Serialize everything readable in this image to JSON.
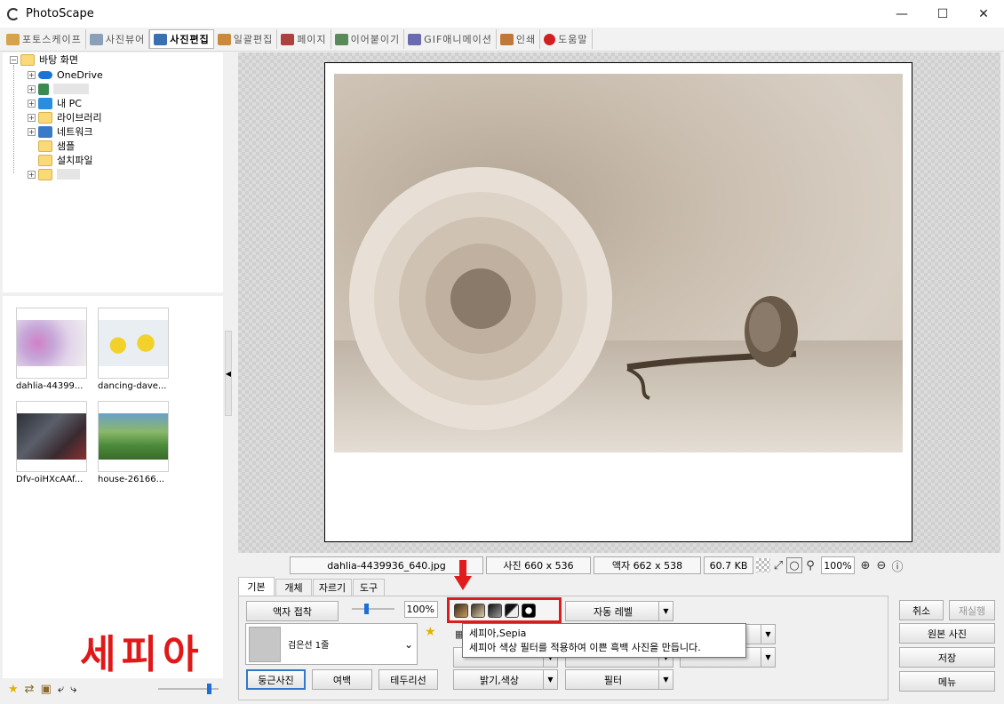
{
  "window": {
    "title": "PhotoScape"
  },
  "tabs": [
    {
      "label": "포토스케이프",
      "color": "#d6a24a"
    },
    {
      "label": "사진뷰어",
      "color": "#8aa0b8"
    },
    {
      "label": "사진편집",
      "color": "#3a6fb0"
    },
    {
      "label": "일괄편집",
      "color": "#c98a3a"
    },
    {
      "label": "페이지",
      "color": "#b04040"
    },
    {
      "label": "이어붙이기",
      "color": "#5a8a5a"
    },
    {
      "label": "GIF애니메이션",
      "color": "#6a6ab0"
    },
    {
      "label": "인쇄",
      "color": "#c07838"
    },
    {
      "label": "도움말",
      "color": "#d02020"
    }
  ],
  "tree": {
    "root": "바탕 화면",
    "items": [
      "OneDrive",
      "",
      "내 PC",
      "라이브러리",
      "네트워크",
      "샘플",
      "설치파일",
      ""
    ]
  },
  "thumbnails": [
    {
      "caption": "dahlia-44399..."
    },
    {
      "caption": "dancing-dave..."
    },
    {
      "caption": "Dfv-oiHXcAAf..."
    },
    {
      "caption": "house-26166..."
    }
  ],
  "status": {
    "filename": "dahlia-4439936_640.jpg",
    "photo_size": "사진 660 x 536",
    "frame_size": "액자 662 x 538",
    "file_size": "60.7 KB",
    "zoom": "100%"
  },
  "panel": {
    "tabs": [
      "기본",
      "개체",
      "자르기",
      "도구"
    ],
    "frame_attach": "액자 접착",
    "opacity": "100%",
    "frame_select": "검은선 1줄",
    "round_photo": "둥근사진",
    "margin": "여백",
    "border_line": "테두리선",
    "auto_level": "자동 레벨",
    "bright_color": "밝기,색상",
    "filter": "필터"
  },
  "right_buttons": {
    "undo": "취소",
    "redo": "재실행",
    "original": "원본 사진",
    "save": "저장",
    "menu": "메뉴"
  },
  "tooltip": {
    "title": "세피아,Sepia",
    "body": "세피아 색상 필터를 적용하여 이쁜 흑백 사진을 만듭니다."
  },
  "caption": "세피아"
}
